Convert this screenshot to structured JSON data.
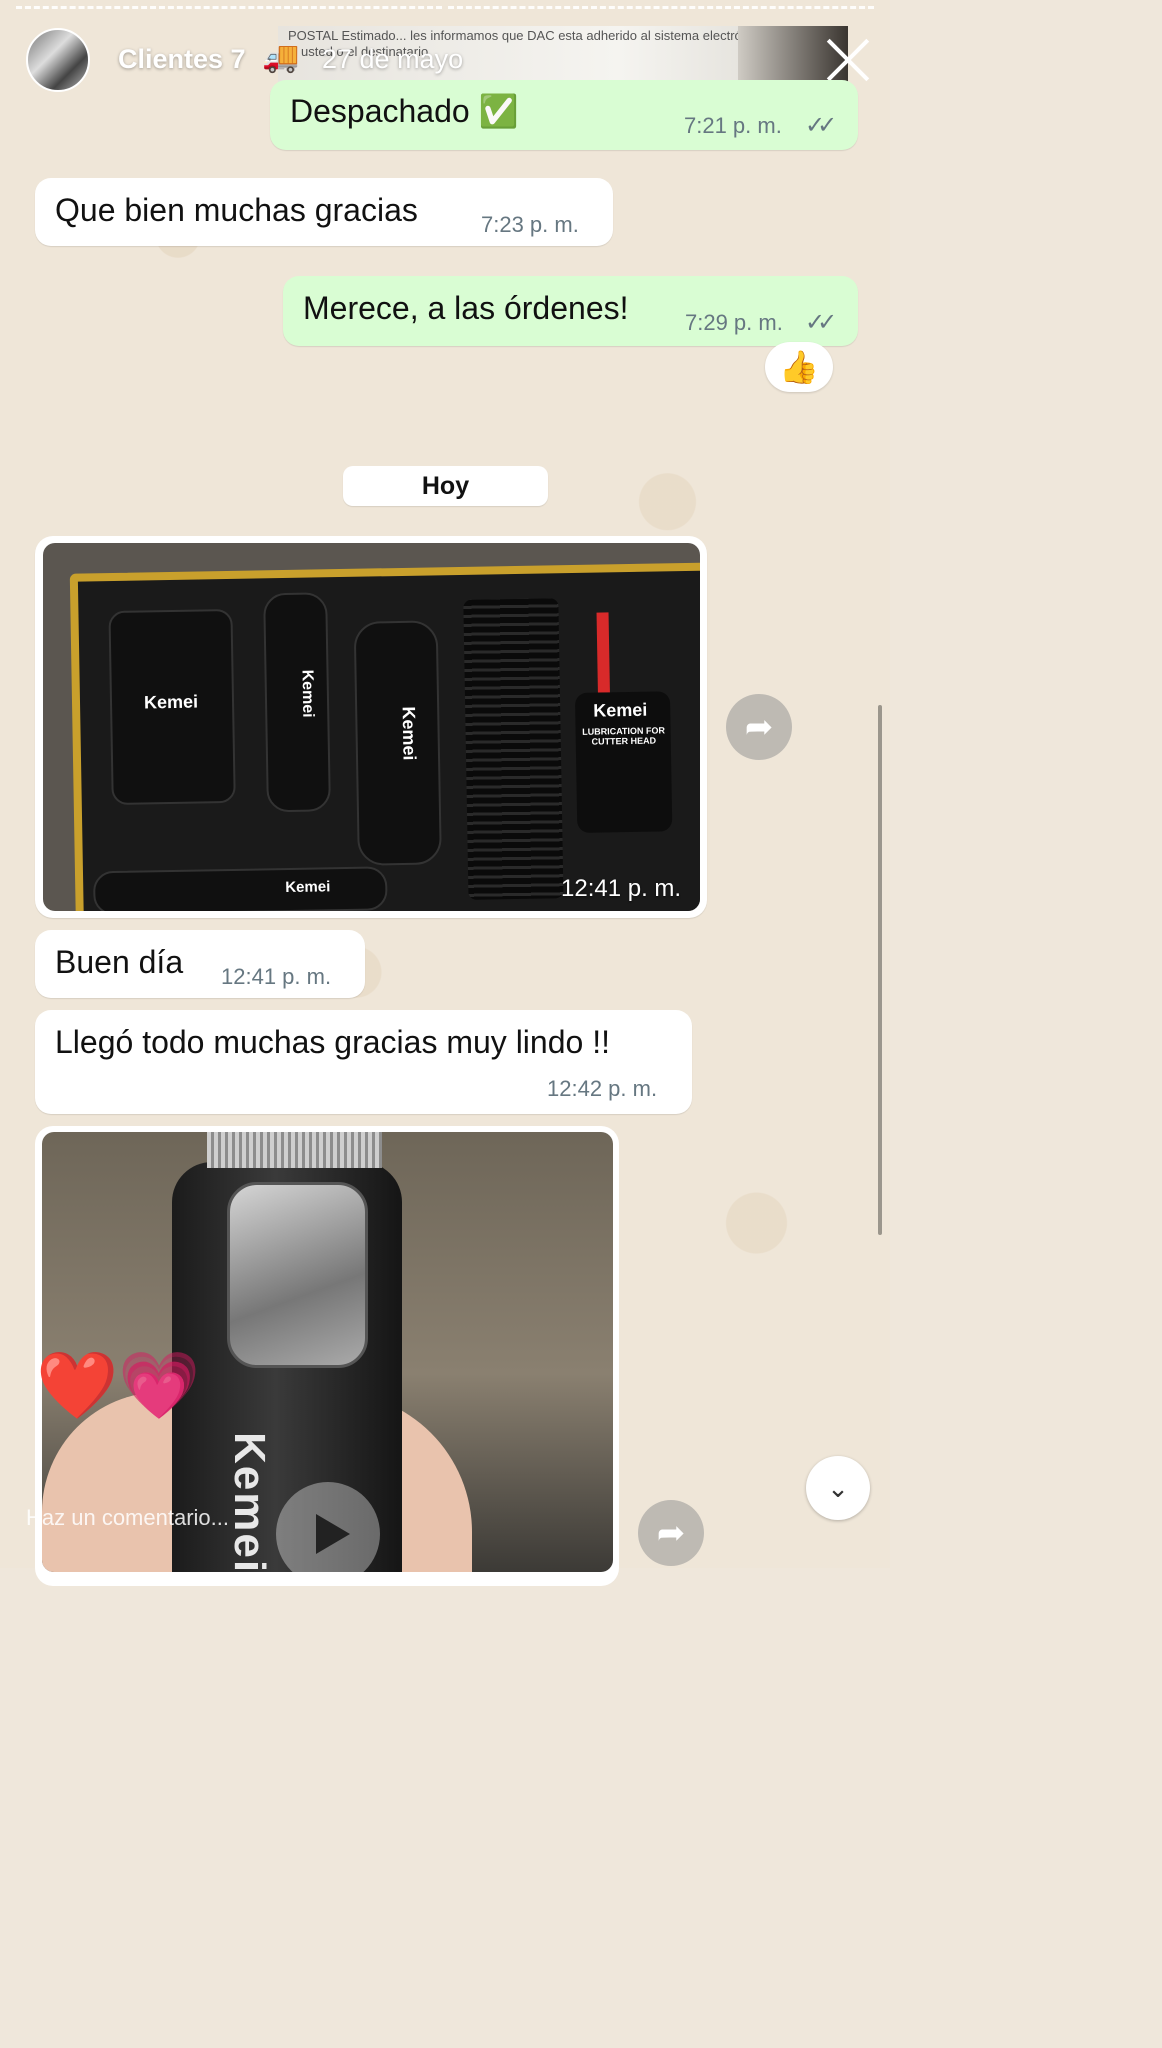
{
  "story": {
    "name": "Clientes 7",
    "emoji": "🚚",
    "date": "27 de mayo",
    "comment_placeholder": "Haz un comentario..."
  },
  "background_document_text": "POSTAL\nEstimado... les informamos que DAC esta adherido al sistema\nelectrónica por lo cual si usted o el destinatario",
  "messages": [
    {
      "type": "out",
      "text": "Despachado ✅",
      "time": "7:21 p. m.",
      "status": "read"
    },
    {
      "type": "in",
      "text": "Que bien muchas gracias",
      "time": "7:23 p. m."
    },
    {
      "type": "out",
      "text": "Merece, a las órdenes!",
      "time": "7:29 p. m.",
      "status": "read",
      "reaction": "👍"
    },
    {
      "type": "in-image",
      "time": "12:41 p. m.",
      "brand_labels": [
        "Kemei",
        "Kemei",
        "Kemei",
        "Kemei",
        "Kemei"
      ],
      "bottle_label": "LUBRICATION FOR CUTTER HEAD"
    },
    {
      "type": "in",
      "text": "Buen día",
      "time": "12:41 p. m."
    },
    {
      "type": "in",
      "text": "Llegó todo muchas gracias muy lindo !!",
      "time": "12:42 p. m."
    },
    {
      "type": "in-video",
      "brand_label": "Kemei"
    }
  ],
  "date_divider": "Hoy",
  "ticks": "✓✓",
  "reaction_emojis": "❤️💗",
  "colors": {
    "outgoing_bubble": "#d9fdd3",
    "incoming_bubble": "#ffffff",
    "time_text": "#667781"
  }
}
